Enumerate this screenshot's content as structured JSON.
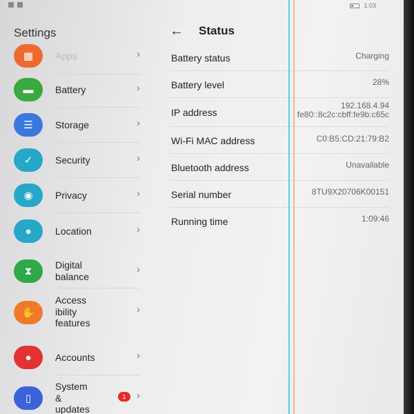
{
  "status_bar": {
    "time": "1:03"
  },
  "settings": {
    "title": "Settings",
    "items": [
      {
        "label": "Apps",
        "icon": "apps-icon",
        "color": "#ef6a2e"
      },
      {
        "label": "Battery",
        "icon": "battery-icon",
        "color": "#3aa93f"
      },
      {
        "label": "Storage",
        "icon": "storage-icon",
        "color": "#3a78e0"
      },
      {
        "label": "Security",
        "icon": "shield-icon",
        "color": "#26a8c9"
      },
      {
        "label": "Privacy",
        "icon": "privacy-icon",
        "color": "#26a8c9"
      },
      {
        "label": "Location",
        "icon": "location-icon",
        "color": "#26a8c9"
      },
      {
        "label": "Digital\nbalance",
        "icon": "hourglass-icon",
        "color": "#2ea84a"
      },
      {
        "label": "Access\nibility\nfeatures",
        "icon": "hand-icon",
        "color": "#ef7b2a"
      },
      {
        "label": "Accounts",
        "icon": "account-icon",
        "color": "#e23232"
      },
      {
        "label": "System\n&\nupdates",
        "icon": "phone-settings-icon",
        "color": "#3a62d9",
        "badge": "1"
      }
    ]
  },
  "status": {
    "title": "Status",
    "rows": [
      {
        "key": "Battery status",
        "value": "Charging"
      },
      {
        "key": "Battery level",
        "value": "28%"
      },
      {
        "key": "IP address",
        "value": "192.168.4.94\nfe80::8c2c:cbff:fe9b:c65c"
      },
      {
        "key": "Wi-Fi MAC address",
        "value": "C0:B5:CD:21:79:B2"
      },
      {
        "key": "Bluetooth address",
        "value": "Unavailable"
      },
      {
        "key": "Serial number",
        "value": "8TU9X20706K00151"
      },
      {
        "key": "Running time",
        "value": "1:09:46"
      }
    ]
  }
}
